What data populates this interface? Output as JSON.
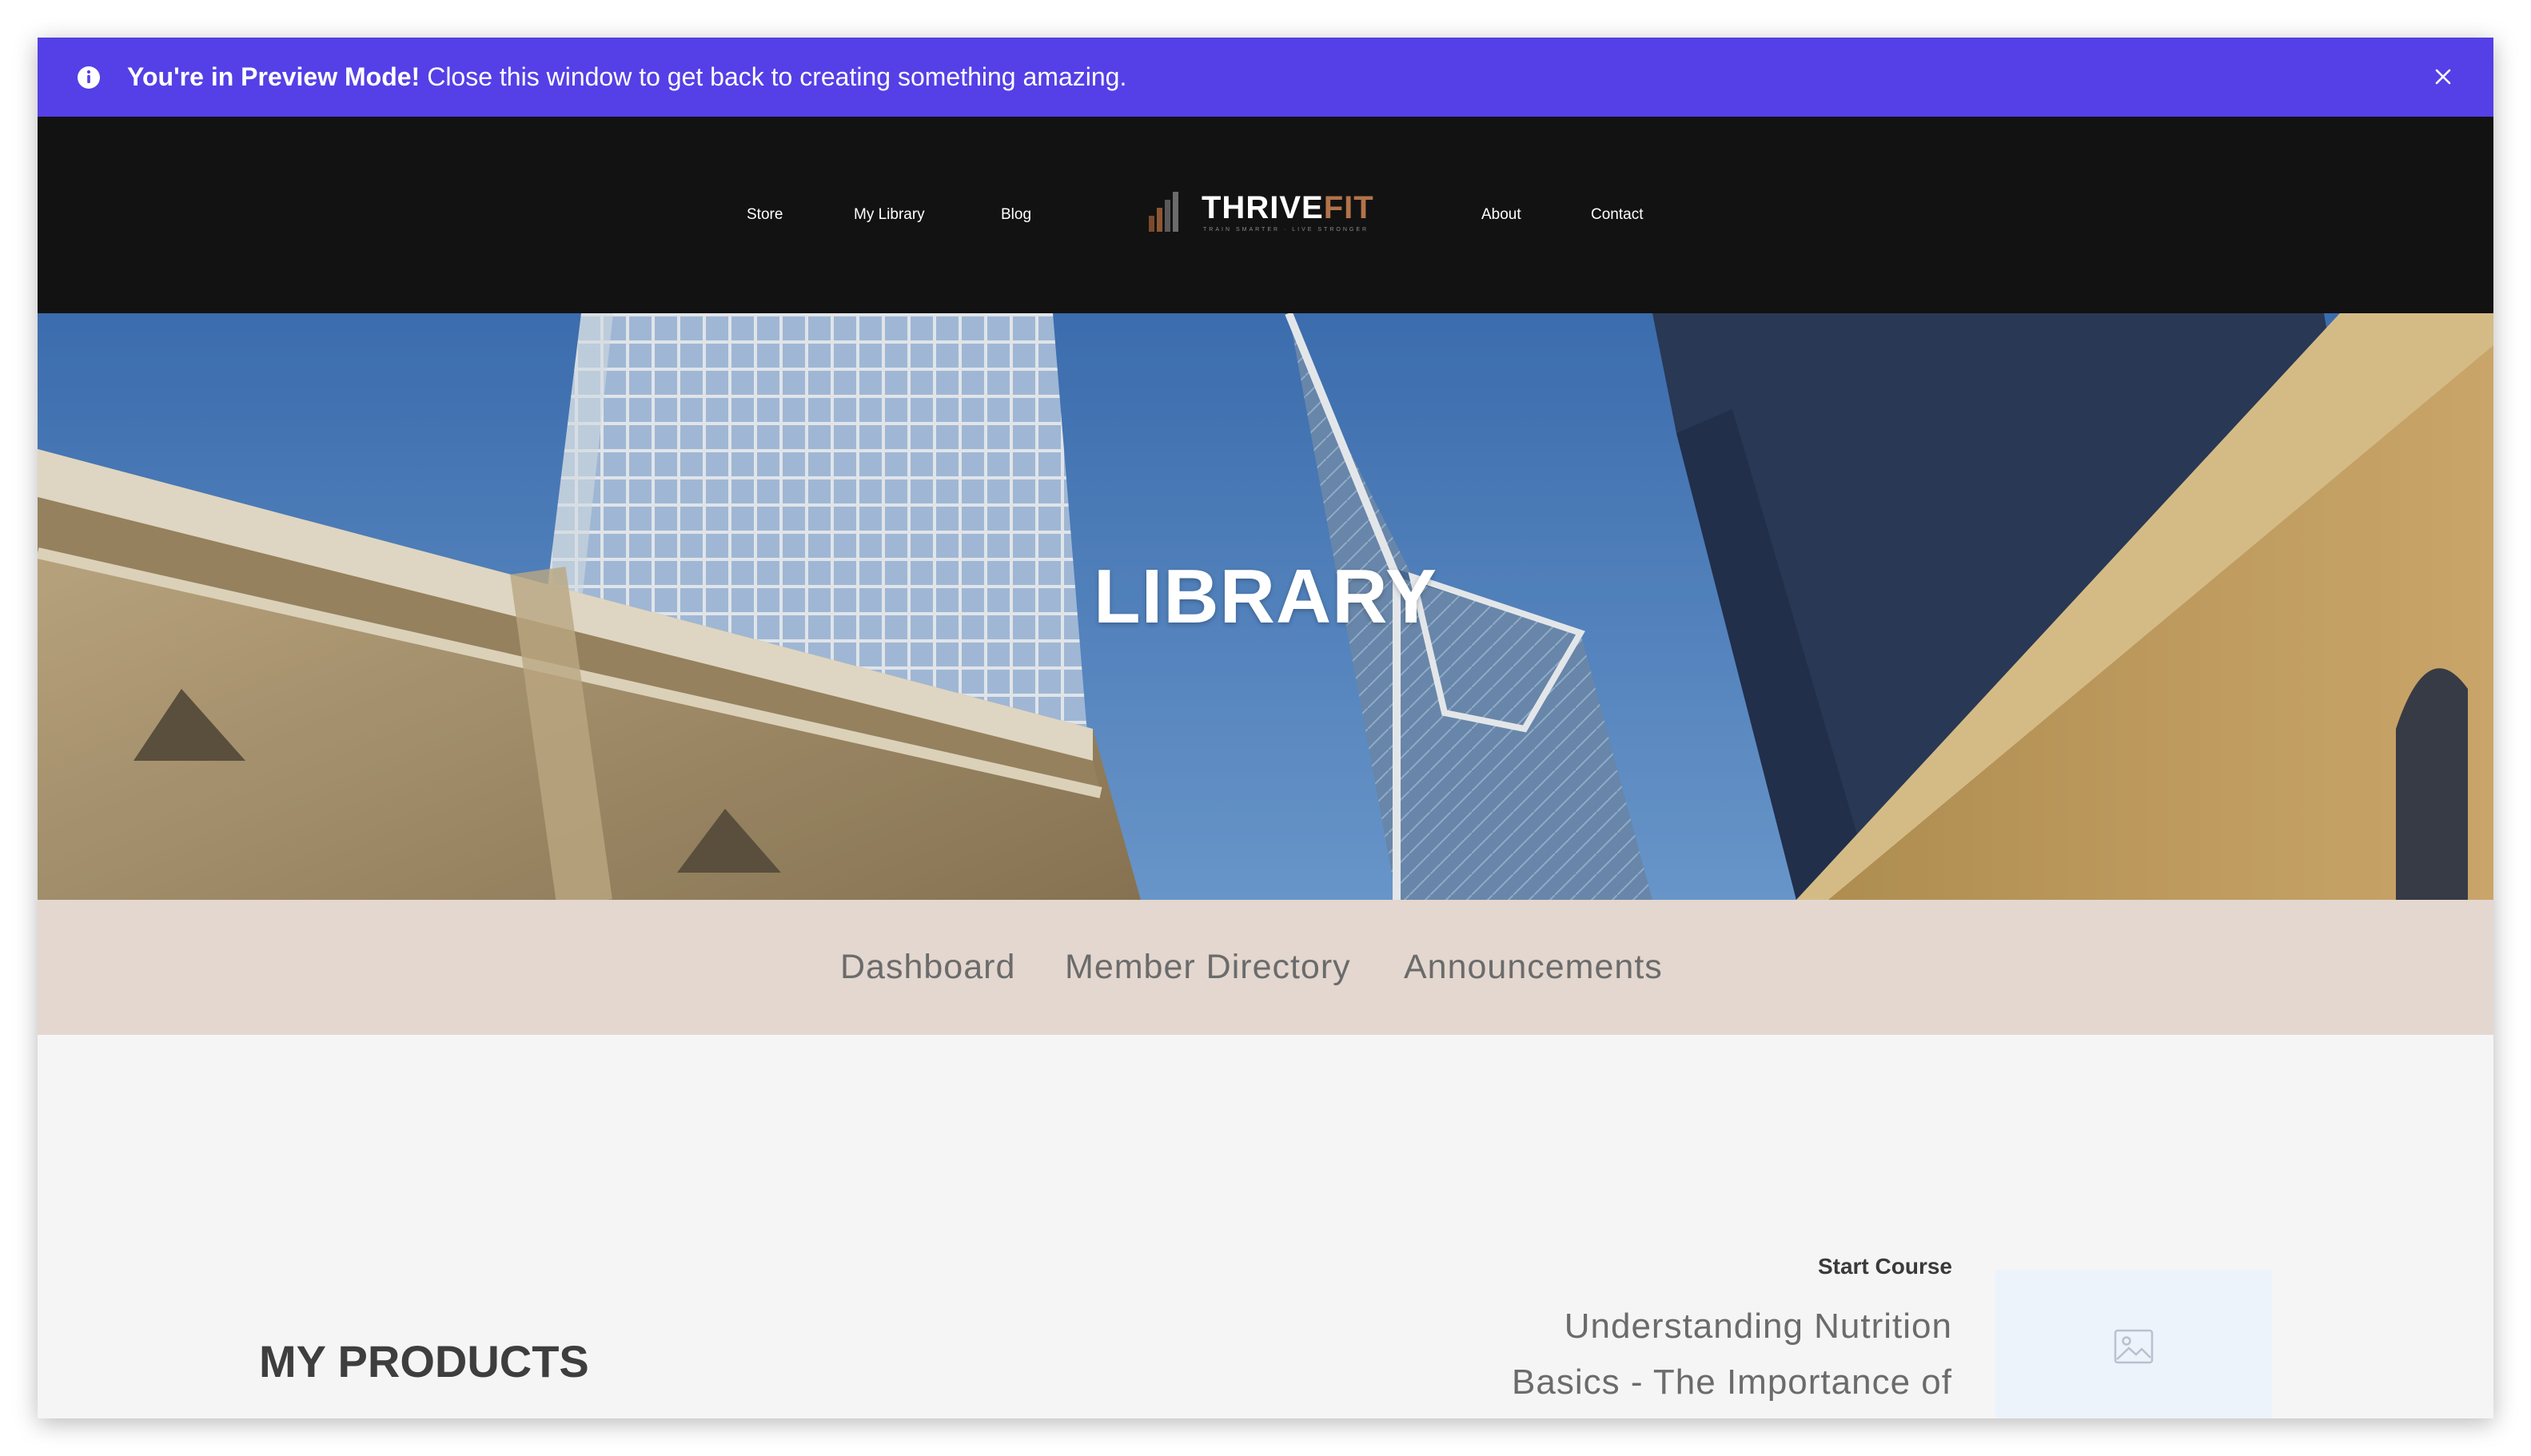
{
  "preview_banner": {
    "bold_text": "You're in Preview Mode!",
    "message": "Close this window to get back to creating something amazing.",
    "info_icon": "info-circle-icon",
    "close_icon": "close-x-icon",
    "background": "#5440e6"
  },
  "header": {
    "nav_left": [
      "Store",
      "My Library",
      "Blog"
    ],
    "nav_right": [
      "About",
      "Contact"
    ],
    "logo": {
      "word1": "THRIVE",
      "word2": "FIT",
      "tagline": "TRAIN SMARTER · LIVE STRONGER",
      "accent": "#b2734a"
    },
    "background": "#121212"
  },
  "hero": {
    "title": "LIBRARY"
  },
  "sub_nav": {
    "items": [
      "Dashboard",
      "Member Directory",
      "Announcements"
    ],
    "background": "#e3d7cf"
  },
  "content": {
    "heading": "MY PRODUCTS",
    "course": {
      "action": "Start Course",
      "title": "Understanding Nutrition Basics - The Importance of Micronutrients",
      "thumbnail_icon": "image-placeholder-icon"
    }
  }
}
